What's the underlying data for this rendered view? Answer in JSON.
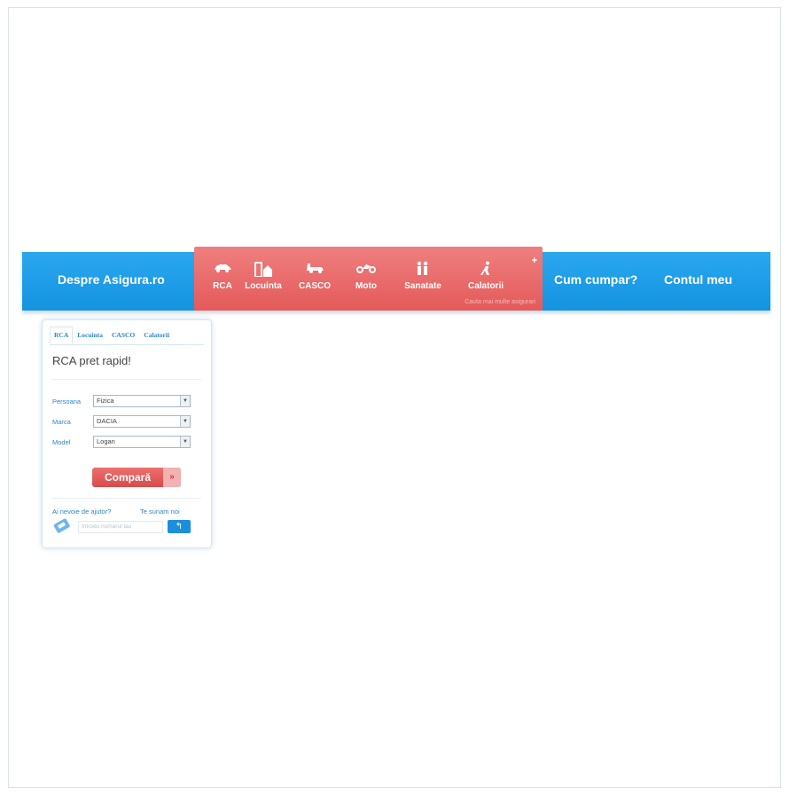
{
  "nav": {
    "about": "Despre Asigura.ro",
    "how_to_buy": "Cum cumpar?",
    "account": "Contul meu",
    "menu_items": [
      {
        "label": "RCA",
        "icon": "car-icon"
      },
      {
        "label": "Locuinta",
        "icon": "building-icon"
      },
      {
        "label": "CASCO",
        "icon": "car-shield-icon"
      },
      {
        "label": "Moto",
        "icon": "motorcycle-icon"
      },
      {
        "label": "Sanatate",
        "icon": "family-icon"
      },
      {
        "label": "Calatorii",
        "icon": "traveler-icon"
      }
    ],
    "more": "+",
    "subtext": "Cauta mai multe asigurari"
  },
  "widget": {
    "tabs": [
      "RCA",
      "Locuinta",
      "CASCO",
      "Calatorii"
    ],
    "title": "RCA pret rapid!",
    "fields": [
      {
        "label": "Persoana",
        "value": "Fizica"
      },
      {
        "label": "Marca",
        "value": "DACIA"
      },
      {
        "label": "Model",
        "value": "Logan"
      }
    ],
    "compare_button": "Compară",
    "compare_arrow": "»",
    "help_question": "Ai nevoie de ajutor?",
    "call_us": "Te sunam noi",
    "phone_placeholder": "Introdu numarul tau",
    "go_arrow": "↰"
  },
  "colors": {
    "nav_blue": "#1b9be8",
    "menu_red": "#e86868",
    "link_blue": "#2c86cc"
  }
}
